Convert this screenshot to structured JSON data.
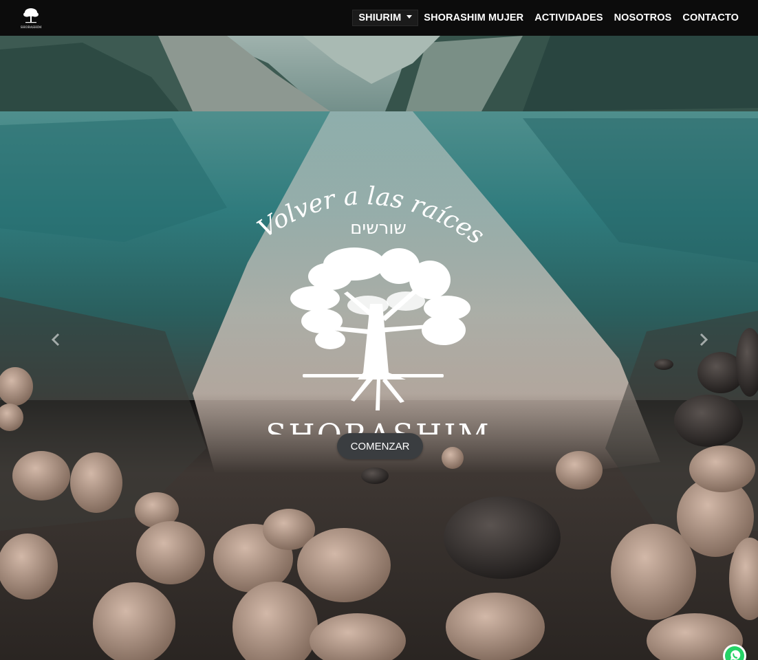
{
  "brand": {
    "logo_icon": "shorashim-tree-logo",
    "logo_text": "SHORASHIM"
  },
  "nav": {
    "items": [
      {
        "label": "SHIURIM",
        "dropdown": true,
        "active": true
      },
      {
        "label": "SHORASHIM MUJER"
      },
      {
        "label": "ACTIVIDADES"
      },
      {
        "label": "NOSOTROS"
      },
      {
        "label": "CONTACTO"
      }
    ]
  },
  "hero": {
    "tagline": "Volver a las raíces",
    "hebrew": "שורשים",
    "name": "SHORASHIM",
    "cta_label": "COMENZAR",
    "prev_icon": "chevron-left-icon",
    "next_icon": "chevron-right-icon"
  },
  "floating": {
    "whatsapp_icon": "whatsapp-icon"
  },
  "colors": {
    "navbar_bg": "#0c0c0c",
    "cta_bg": "#3a3d40",
    "water": "#2f7b7d"
  }
}
